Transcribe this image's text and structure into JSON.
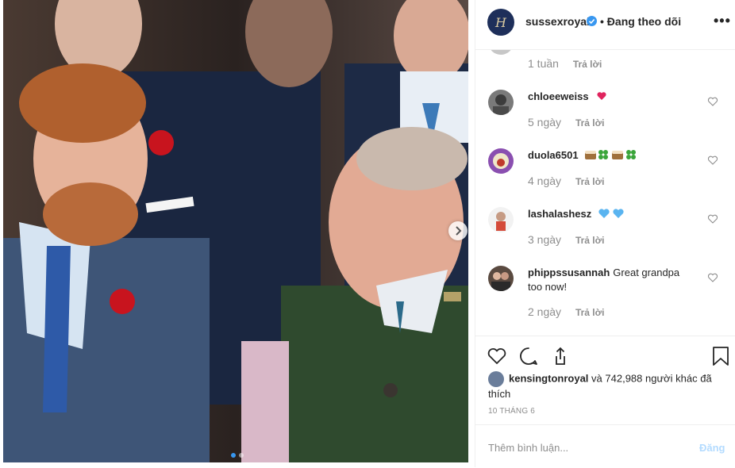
{
  "post": {
    "carousel": {
      "dots": 2,
      "active_index": 0
    }
  },
  "header": {
    "avatar_initial": "H",
    "username": "sussexroyal",
    "follow_state": "• Đang theo dõi",
    "more_icon": "more-dots-icon"
  },
  "comments": {
    "previous_meta": {
      "time": "1 tuần",
      "reply": "Trả lời"
    },
    "items": [
      {
        "username": "chloeeweiss",
        "text": "",
        "emoji": "heart",
        "time": "5 ngày",
        "reply": "Trả lời"
      },
      {
        "username": "duola6501",
        "text": "",
        "emoji": "cake-clover",
        "time": "4 ngày",
        "reply": "Trả lời"
      },
      {
        "username": "lashalashesz",
        "text": "",
        "emoji": "blue-hearts",
        "time": "3 ngày",
        "reply": "Trả lời"
      },
      {
        "username": "phippssusannah",
        "text": "Great grandpa too now!",
        "time": "2 ngày",
        "reply": "Trả lời"
      }
    ]
  },
  "likes": {
    "liker": "kensingtonroyal",
    "summary": "và 742,988 người khác đã thích"
  },
  "date": "10 THÁNG 6",
  "composer": {
    "placeholder": "Thêm bình luận...",
    "post_label": "Đăng"
  },
  "colors": {
    "verified": "#3897f0",
    "post_disabled": "#b3dbff",
    "muted": "#8e8e8e"
  }
}
